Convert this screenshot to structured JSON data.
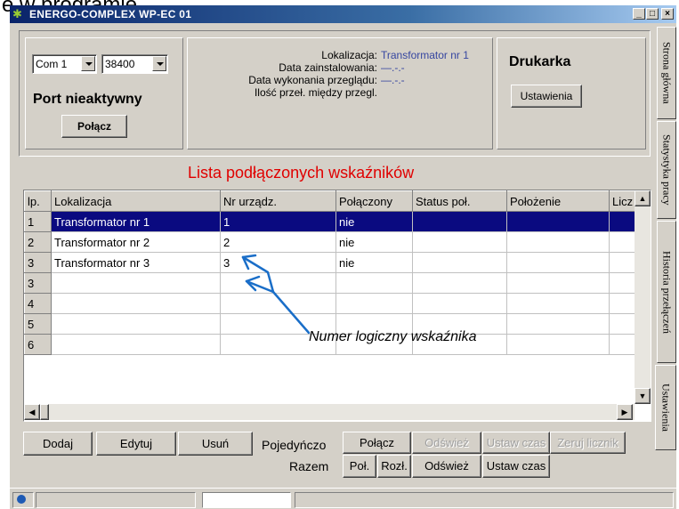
{
  "caption": "e w programie",
  "window": {
    "title": "ENERGO-COMPLEX WP-EC 01",
    "buttons": [
      "_",
      "□",
      "×"
    ]
  },
  "port": {
    "com_value": "Com 1",
    "baud_value": "38400",
    "status": "Port nieaktywny",
    "connect_label": "Połącz"
  },
  "info": {
    "rows": [
      {
        "label": "Lokalizacja:",
        "value": "Transformator nr 1"
      },
      {
        "label": "Data zainstalowania:",
        "value": "—.-.-"
      },
      {
        "label": "Data wykonania przeglądu:",
        "value": "—.-.-"
      },
      {
        "label": "Ilość przeł. między przegl.",
        "value": ""
      }
    ]
  },
  "printer": {
    "title": "Drukarka",
    "settings_label": "Ustawienia"
  },
  "list": {
    "title": "Lista podłączonych wskaźników",
    "columns": [
      "lp.",
      "Lokalizacja",
      "Nr urządz.",
      "Połączony",
      "Status poł.",
      "Położenie",
      "Licz"
    ],
    "rows": [
      {
        "lp": "1",
        "lok": "Transformator nr 1",
        "nr": "1",
        "pol": "nie",
        "status": "",
        "poloz": "",
        "licz": ""
      },
      {
        "lp": "2",
        "lok": "Transformator nr 2",
        "nr": "2",
        "pol": "nie",
        "status": "",
        "poloz": "",
        "licz": ""
      },
      {
        "lp": "3",
        "lok": "Transformator nr 3",
        "nr": "3",
        "pol": "nie",
        "status": "",
        "poloz": "",
        "licz": ""
      },
      {
        "lp": "3",
        "lok": "",
        "nr": "",
        "pol": "",
        "status": "",
        "poloz": "",
        "licz": ""
      },
      {
        "lp": "4",
        "lok": "",
        "nr": "",
        "pol": "",
        "status": "",
        "poloz": "",
        "licz": ""
      },
      {
        "lp": "5",
        "lok": "",
        "nr": "",
        "pol": "",
        "status": "",
        "poloz": "",
        "licz": ""
      },
      {
        "lp": "6",
        "lok": "",
        "nr": "",
        "pol": "",
        "status": "",
        "poloz": "",
        "licz": ""
      }
    ]
  },
  "annotation": "Numer logiczny wskaźnika",
  "tabs": [
    "Strona główna",
    "Statystyka pracy",
    "Historia przełączeń",
    "Ustawienia"
  ],
  "actions": {
    "add": "Dodaj",
    "edit": "Edytuj",
    "delete": "Usuń",
    "single_label": "Pojedyńczo",
    "single_connect": "Połącz",
    "single_refresh": "Odśwież",
    "single_set_time": "Ustaw czas",
    "single_reset": "Zeruj licznik",
    "all_label": "Razem",
    "all_connect": "Poł.",
    "all_disconnect": "Rozł.",
    "all_refresh": "Odśwież",
    "all_set_time": "Ustaw czas"
  },
  "colors": {
    "selection": "#0a0a80",
    "list_title": "#e00000",
    "info_value": "#3646a0",
    "annotation_arrow": "#1a6ec8"
  }
}
